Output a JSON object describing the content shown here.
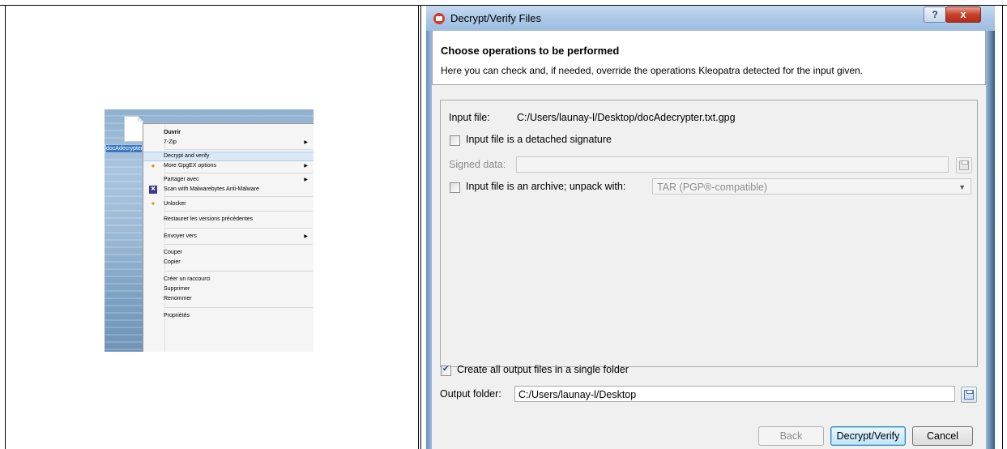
{
  "context_menu": {
    "file_name": "docAdecrypter.txt.gpg",
    "items": [
      {
        "label": "Ouvrir",
        "bold": true
      },
      {
        "label": "7-Zip",
        "submenu": true
      },
      {
        "label": "Decrypt and verify",
        "highlighted": true
      },
      {
        "label": "More GpgEX options",
        "submenu": true,
        "icon": "lock-icon"
      },
      {
        "label": "Partager avec",
        "submenu": true
      },
      {
        "label": "Scan with Malwarebytes Anti-Malware",
        "icon": "malwarebytes-icon"
      },
      {
        "label": "Unlocker",
        "icon": "wand-icon"
      },
      {
        "label": "Restaurer les versions précédentes"
      },
      {
        "label": "Envoyer vers",
        "submenu": true
      },
      {
        "label": "Couper"
      },
      {
        "label": "Copier"
      },
      {
        "label": "Créer un raccourci"
      },
      {
        "label": "Supprimer"
      },
      {
        "label": "Renommer"
      },
      {
        "label": "Propriétés"
      }
    ]
  },
  "dialog": {
    "title": "Decrypt/Verify Files",
    "help_button": "?",
    "close_button": "x",
    "header_title": "Choose operations to be performed",
    "header_subtitle": "Here you can check and, if needed, override the operations Kleopatra detected for the input given.",
    "input_file_label": "Input file:",
    "input_file_value": "C:/Users/launay-l/Desktop/docAdecrypter.txt.gpg",
    "detached_signature_label": "Input file is a detached signature",
    "detached_signature_checked": false,
    "signed_data_label": "Signed data:",
    "signed_data_value": "",
    "archive_label": "Input file is an archive; unpack with:",
    "archive_checked": false,
    "archive_format": "TAR (PGP®-compatible)",
    "single_folder_label": "Create all output files in a single folder",
    "single_folder_checked": true,
    "output_folder_label": "Output folder:",
    "output_folder_value": "C:/Users/launay-l/Desktop",
    "buttons": {
      "back": "Back",
      "decrypt_verify": "Decrypt/Verify",
      "cancel": "Cancel"
    }
  }
}
